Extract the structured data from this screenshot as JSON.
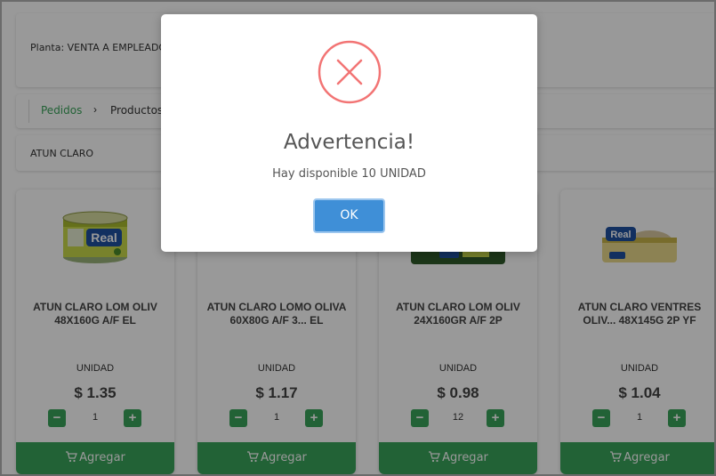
{
  "header": {
    "plant_label": "Planta: VENTA A EMPLEADOS"
  },
  "breadcrumb": {
    "root": "Pedidos",
    "separator": "›",
    "current": "Productos"
  },
  "search": {
    "value": "ATUN CLARO"
  },
  "products": [
    {
      "name": "ATUN CLARO LOM OLIV 48X160G A/F EL",
      "unit": "UNIDAD",
      "price": "$ 1.35",
      "qty": "1",
      "add_label": "Agregar"
    },
    {
      "name": "ATUN CLARO LOMO OLIVA 60X80G A/F 3... EL",
      "unit": "UNIDAD",
      "price": "$ 1.17",
      "qty": "1",
      "add_label": "Agregar"
    },
    {
      "name": "ATUN CLARO LOM OLIV 24X160GR A/F 2P",
      "unit": "UNIDAD",
      "price": "$ 0.98",
      "qty": "12",
      "add_label": "Agregar"
    },
    {
      "name": "ATUN CLARO VENTRES OLIV... 48X145G 2P YF",
      "unit": "UNIDAD",
      "price": "$ 1.04",
      "qty": "1",
      "add_label": "Agregar"
    }
  ],
  "product_brand": "Real",
  "qty_controls": {
    "minus": "−",
    "plus": "+"
  },
  "modal": {
    "title": "Advertencia!",
    "message": "Hay disponible 10 UNIDAD",
    "ok_label": "OK",
    "icon": "error-x-icon",
    "icon_color": "#f27474",
    "button_color": "#3f8fd7"
  },
  "colors": {
    "accent_green": "#3aa35a"
  }
}
